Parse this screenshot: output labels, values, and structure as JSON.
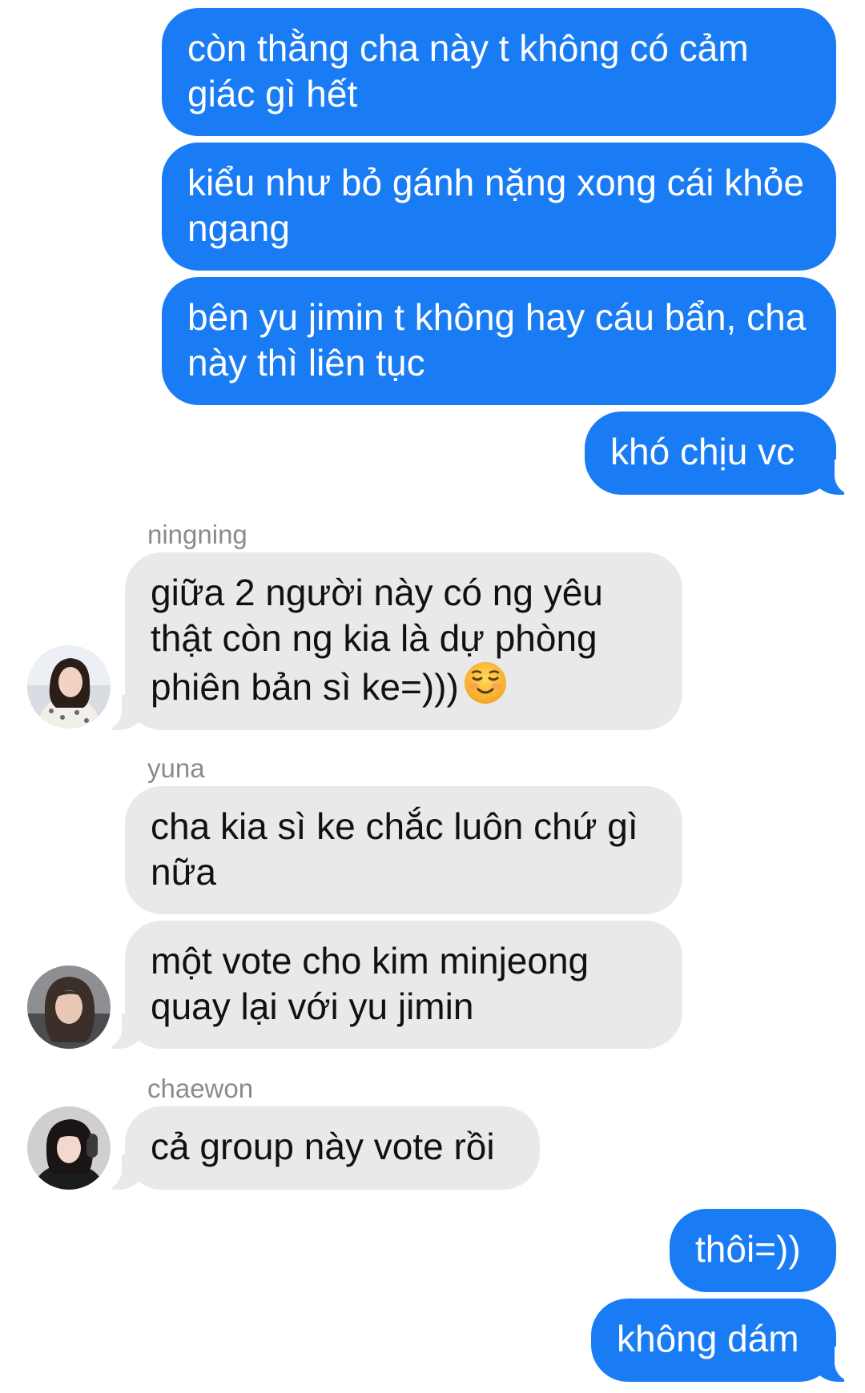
{
  "messages": [
    {
      "text": "còn thằng cha này t không có cảm giác gì hết"
    },
    {
      "text": "kiểu như bỏ gánh nặng xong cái khỏe ngang"
    },
    {
      "text": "bên yu jimin t không hay cáu bẩn, cha này thì liên tục"
    },
    {
      "text": "khó chịu vc"
    },
    {
      "sender": "ningning",
      "text": "giữa 2 người này có ng yêu thật còn ng kia là dự phòng phiên bản sì ke=)))",
      "emoji": "smiling-face-icon"
    },
    {
      "sender": "yuna",
      "text": "cha kia sì ke chắc luôn chứ gì nữa"
    },
    {
      "text": "một vote cho kim minjeong quay lại với yu jimin"
    },
    {
      "sender": "chaewon",
      "text": "cả group này vote rồi"
    },
    {
      "text": "thôi=))"
    },
    {
      "text": "không dám"
    }
  ],
  "colors": {
    "outgoing_bubble": "#1a7cf5",
    "incoming_bubble": "#e9e9eb",
    "sender_name": "#8b8b8f",
    "background": "#ffffff"
  }
}
